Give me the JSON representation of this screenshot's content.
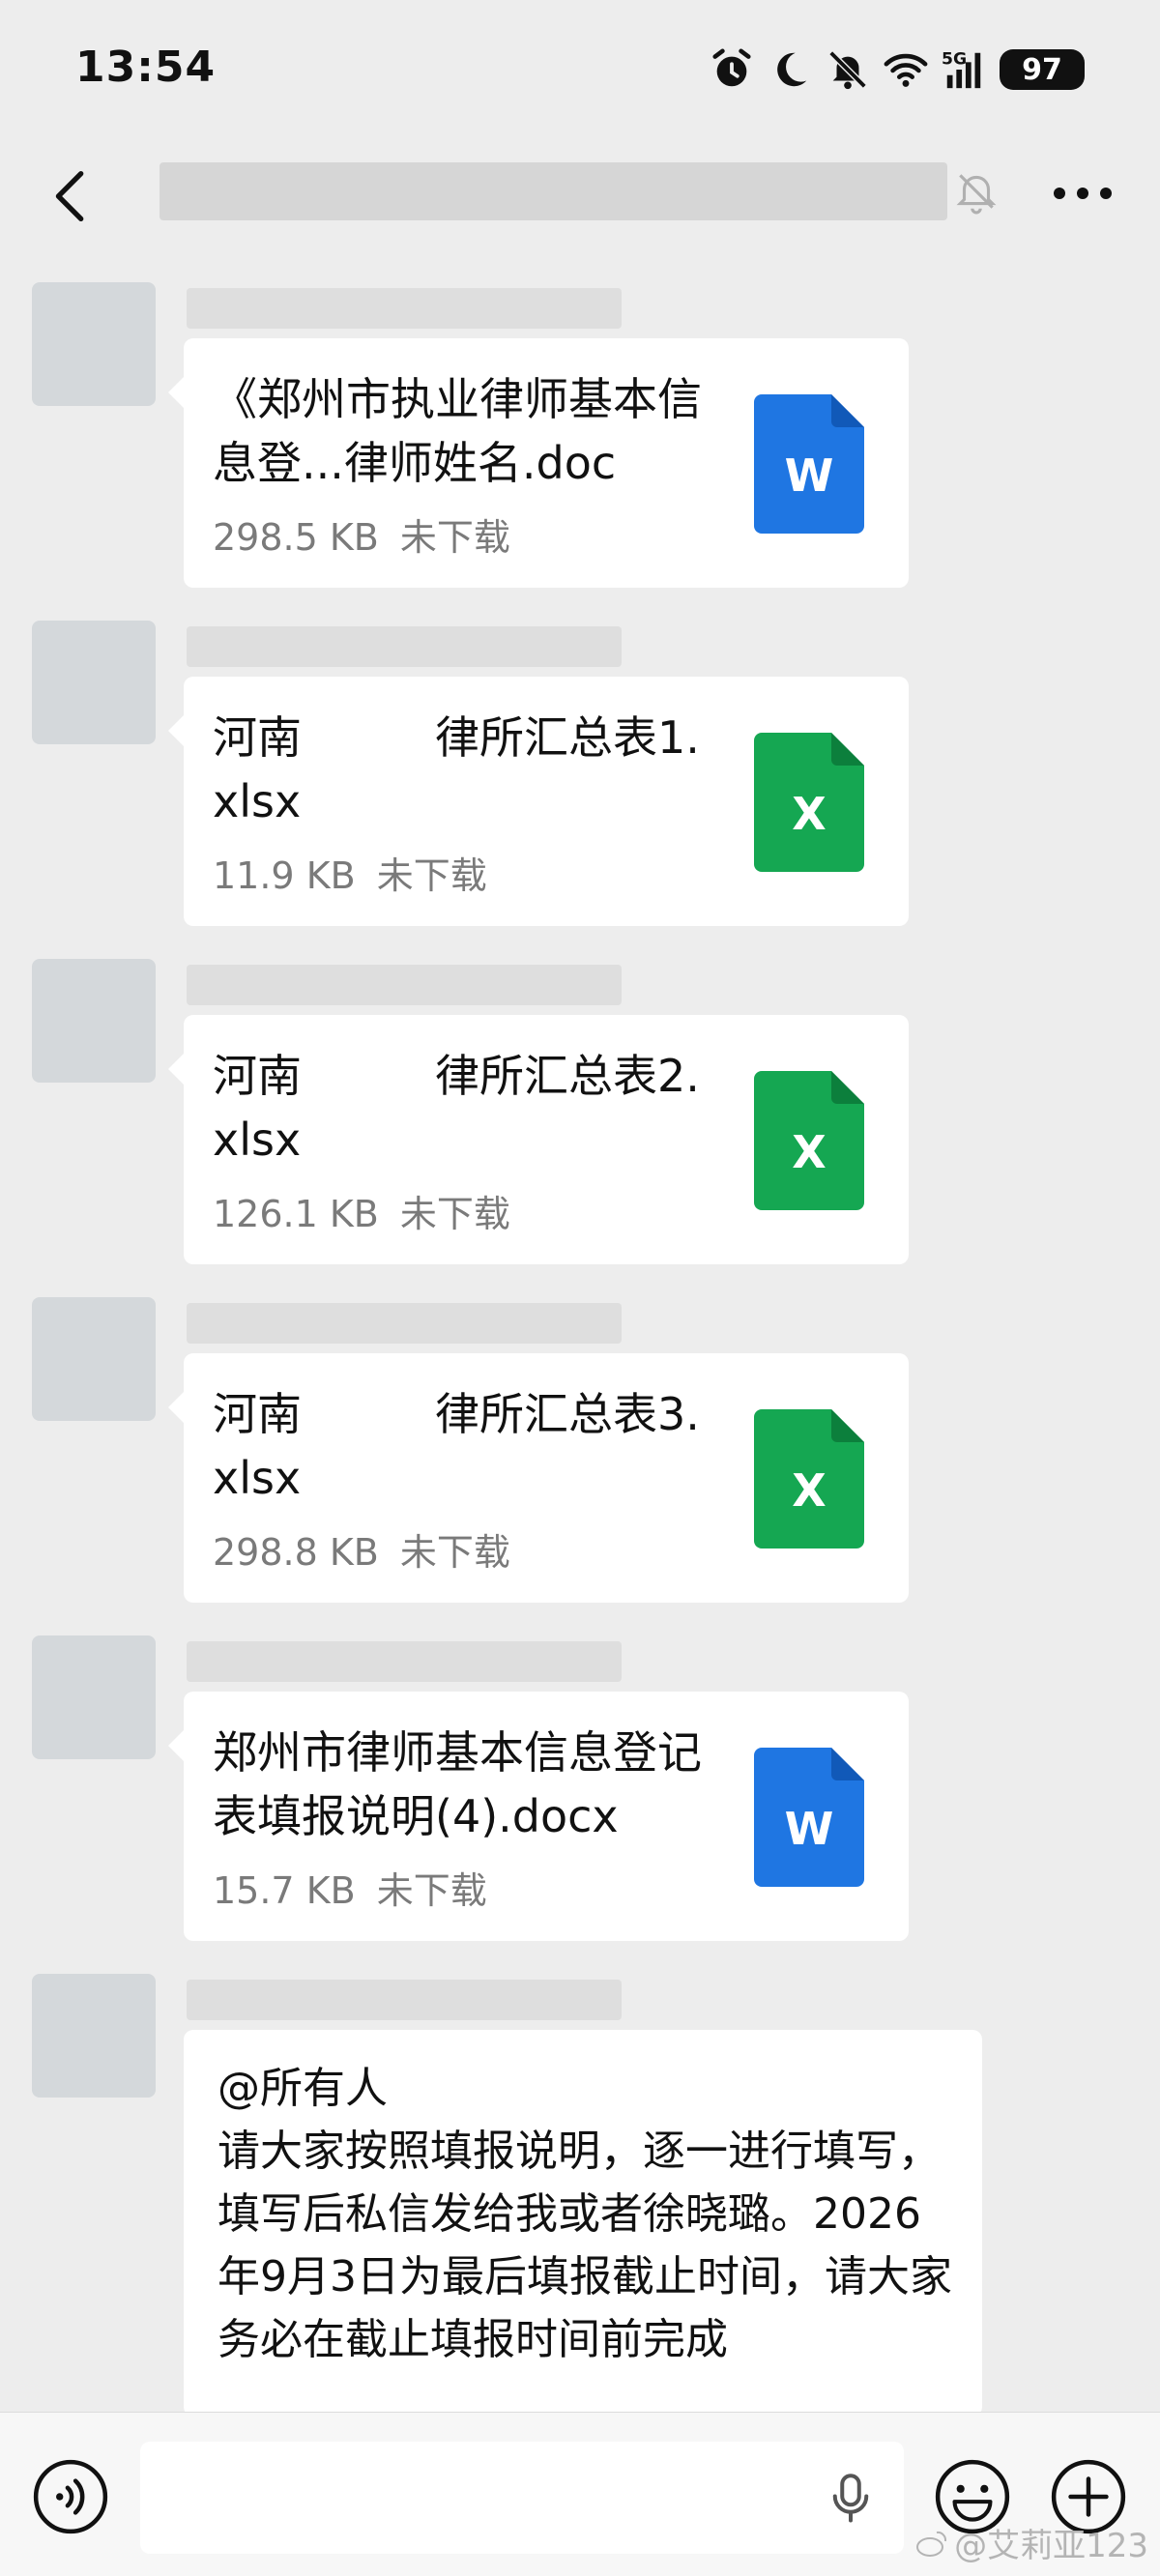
{
  "status_bar": {
    "time": "13:54",
    "network": "5G",
    "battery": "97",
    "icons": [
      "alarm-icon",
      "moon-icon",
      "bell-off-icon",
      "wifi-icon",
      "signal-icon",
      "battery-icon"
    ]
  },
  "header": {
    "back_icon": "chevron-left-icon",
    "mute_icon": "bell-off-icon",
    "more_icon": "more-icon"
  },
  "messages": [
    {
      "type": "file",
      "file_name": "《郑州市执业律师基本信息登...律师姓名.doc",
      "size": "298.5 KB",
      "status": "未下载",
      "file_type": "word",
      "icon_letter": "W"
    },
    {
      "type": "file",
      "file_name": "河南　　　律所汇总表1.xlsx",
      "size": "11.9 KB",
      "status": "未下载",
      "file_type": "excel",
      "icon_letter": "X"
    },
    {
      "type": "file",
      "file_name": "河南　　　律所汇总表2.xlsx",
      "size": "126.1 KB",
      "status": "未下载",
      "file_type": "excel",
      "icon_letter": "X"
    },
    {
      "type": "file",
      "file_name": "河南　　　律所汇总表3.xlsx",
      "size": "298.8 KB",
      "status": "未下载",
      "file_type": "excel",
      "icon_letter": "X"
    },
    {
      "type": "file",
      "file_name": "郑州市律师基本信息登记表填报说明(4).docx",
      "size": "15.7 KB",
      "status": "未下载",
      "file_type": "word",
      "icon_letter": "W"
    },
    {
      "type": "text",
      "text": "@所有人\n请大家按照填报说明，逐一进行填写，填写后私信发给我或者徐晓璐。2026年9月3日为最后填报截止时间，请大家务必在截止填报时间前完成"
    }
  ],
  "colors": {
    "word": "#1f76e2",
    "excel": "#15a752",
    "background": "#ededed"
  },
  "input_bar": {
    "icons": [
      "voice-icon",
      "mic-icon",
      "emoji-icon",
      "plus-icon"
    ]
  },
  "watermark": {
    "text": "@艾莉亚123"
  }
}
